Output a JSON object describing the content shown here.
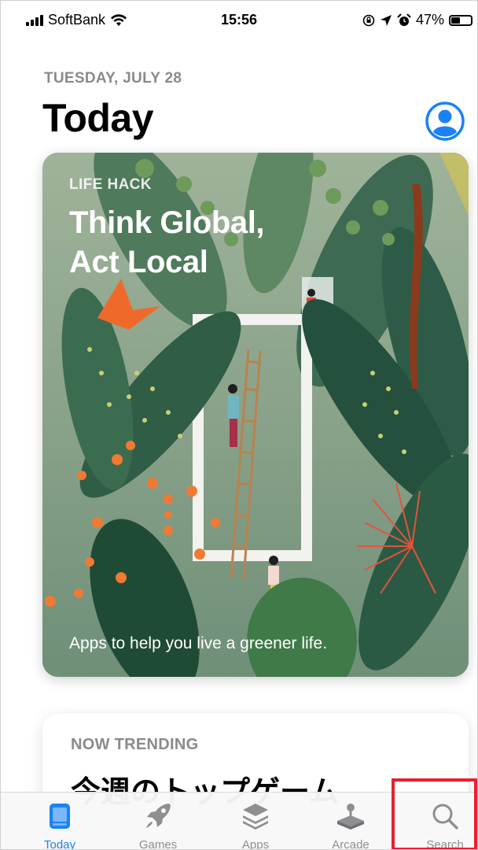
{
  "status_bar": {
    "carrier": "SoftBank",
    "time": "15:56",
    "battery_percent": "47%",
    "battery_level": 0.47
  },
  "header": {
    "date": "TUESDAY, JULY 28",
    "title": "Today"
  },
  "feature_card": {
    "eyebrow": "LIFE HACK",
    "headline_line1": "Think Global,",
    "headline_line2": "Act Local",
    "caption": "Apps to help you live a greener life."
  },
  "trending_card": {
    "eyebrow": "NOW TRENDING",
    "heading": "今週のトップゲーム"
  },
  "tabs": [
    {
      "label": "Today",
      "icon": "today-icon",
      "active": true
    },
    {
      "label": "Games",
      "icon": "rocket-icon",
      "active": false
    },
    {
      "label": "Apps",
      "icon": "layers-icon",
      "active": false
    },
    {
      "label": "Arcade",
      "icon": "joystick-icon",
      "active": false
    },
    {
      "label": "Search",
      "icon": "search-icon",
      "active": false
    }
  ],
  "colors": {
    "accent": "#1a82f6",
    "inactive_tab": "#8e8e93",
    "highlight_box": "#e8212d"
  }
}
